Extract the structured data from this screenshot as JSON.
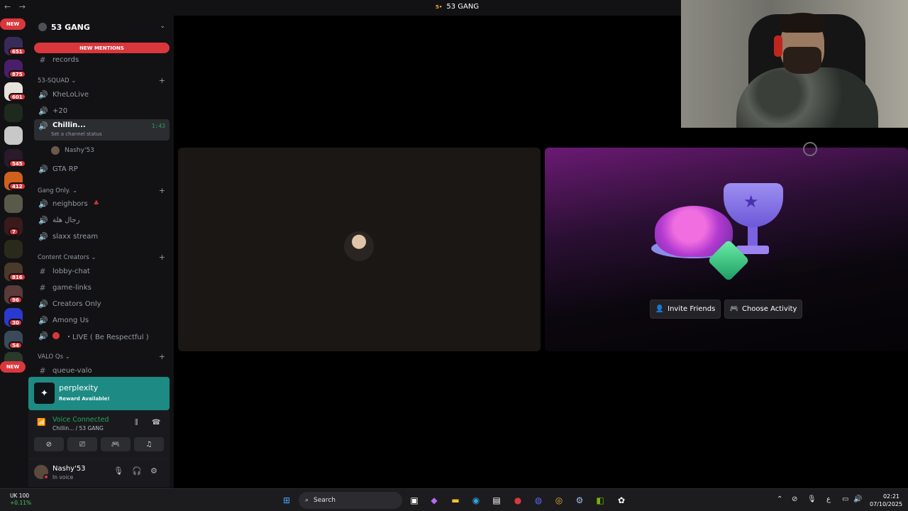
{
  "window": {
    "nav_glyph": "←  →",
    "server_badge": "5•",
    "title": "53 GANG"
  },
  "rail": {
    "top_pill": "NEW",
    "bottom_pill": "NEW",
    "badges": [
      "651",
      "875",
      "601",
      "545",
      "412",
      "7",
      "816",
      "96",
      "30",
      "54"
    ]
  },
  "guild": {
    "name": "53 GANG",
    "new_mentions": "NEW MENTIONS"
  },
  "channels": {
    "records": "records",
    "cat_squad": "53-SQUAD",
    "khelolive": "KheLoLive",
    "plus20": "+20",
    "chillin": "Chillin...",
    "chillin_status": "Set a channel status",
    "chillin_time": "1:43",
    "member": "Nashy'53",
    "gtarp": "GTA RP",
    "cat_gang": "Gang Only.",
    "neighbors": "neighbors",
    "arabic": "رجال هلة",
    "slaxx": "slaxx stream",
    "cat_creators": "Content Creators",
    "lobby": "lobby-chat",
    "gamelinks": "game-links",
    "creators_only": "Creators Only",
    "among": "Among Us",
    "live": "・LIVE ( Be Respectful )",
    "cat_valo": "VALO Qs",
    "queue": "queue-valo"
  },
  "promo": {
    "name": "perplexity",
    "reward": "Reward Available!"
  },
  "voice": {
    "status": "Voice Connected",
    "location": "Chillin... / 53 GANG"
  },
  "user": {
    "name": "Nashy'53",
    "status": "In voice"
  },
  "activity": {
    "invite": "Invite Friends",
    "choose": "Choose Activity"
  },
  "taskbar": {
    "weather_label": "UK 100",
    "weather_change": "+0.11%",
    "search": "Search",
    "lang": "ع",
    "time": "02:21",
    "date": "07/10/2025"
  },
  "colors": {
    "accent_red": "#da373c",
    "voice_green": "#23a55a",
    "promo_teal": "#1e8a84"
  }
}
